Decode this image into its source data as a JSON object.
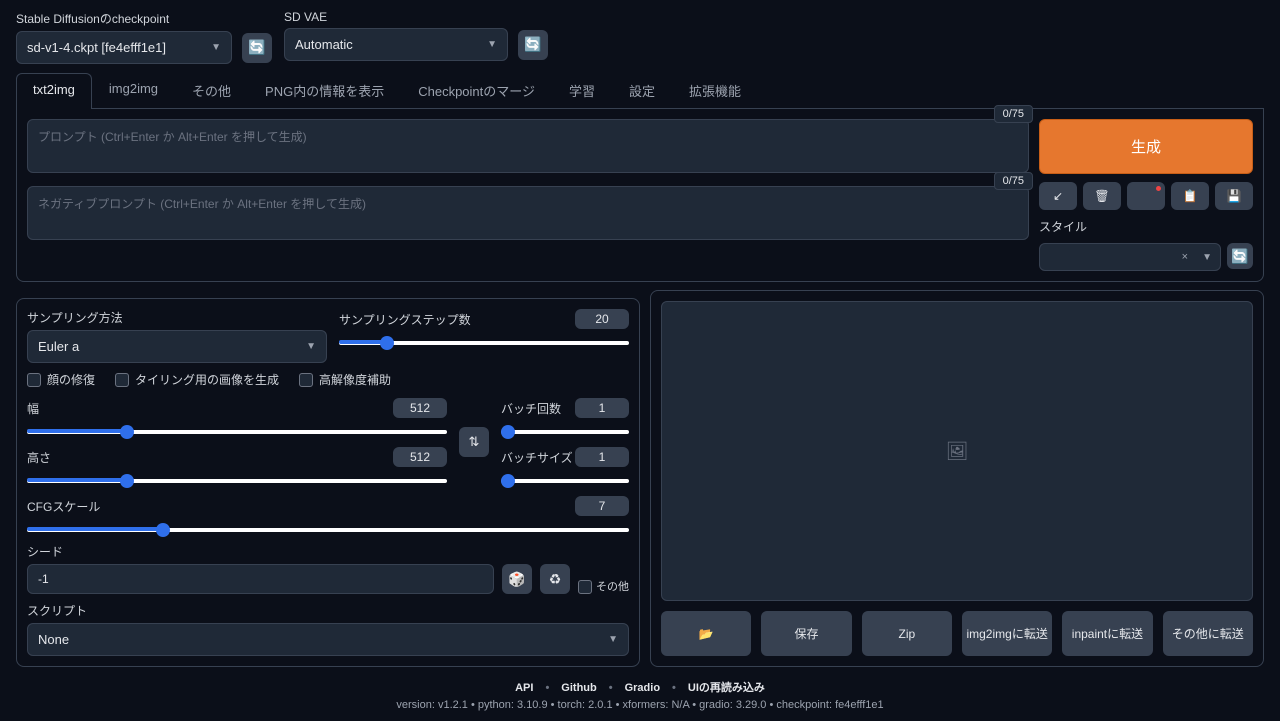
{
  "topbar": {
    "checkpoint_label": "Stable Diffusionのcheckpoint",
    "checkpoint_value": "sd-v1-4.ckpt [fe4efff1e1]",
    "vae_label": "SD VAE",
    "vae_value": "Automatic"
  },
  "tabs": [
    "txt2img",
    "img2img",
    "その他",
    "PNG内の情報を表示",
    "Checkpointのマージ",
    "学習",
    "設定",
    "拡張機能"
  ],
  "active_tab": 0,
  "prompt": {
    "placeholder": "プロンプト (Ctrl+Enter か Alt+Enter を押して生成)",
    "tokens": "0/75"
  },
  "neg_prompt": {
    "placeholder": "ネガティブプロンプト (Ctrl+Enter か Alt+Enter を押して生成)",
    "tokens": "0/75"
  },
  "generate": "生成",
  "style_label": "スタイル",
  "sampling": {
    "method_label": "サンプリング方法",
    "method_value": "Euler a",
    "steps_label": "サンプリングステップ数",
    "steps_value": "20",
    "steps_pct": 15
  },
  "checks": {
    "restore_faces": "顔の修復",
    "tiling": "タイリング用の画像を生成",
    "hires": "高解像度補助"
  },
  "width": {
    "label": "幅",
    "value": "512",
    "pct": 23
  },
  "height": {
    "label": "高さ",
    "value": "512",
    "pct": 23
  },
  "batch_count": {
    "label": "バッチ回数",
    "value": "1",
    "pct": 0
  },
  "batch_size": {
    "label": "バッチサイズ",
    "value": "1",
    "pct": 0
  },
  "cfg": {
    "label": "CFGスケール",
    "value": "7",
    "pct": 22
  },
  "seed": {
    "label": "シード",
    "value": "-1",
    "extra": "その他"
  },
  "script": {
    "label": "スクリプト",
    "value": "None"
  },
  "out_btns": {
    "folder": "📂",
    "save": "保存",
    "zip": "Zip",
    "img2img": "img2imgに転送",
    "inpaint": "inpaintに転送",
    "extras": "その他に転送"
  },
  "footer": {
    "links": [
      "API",
      "Github",
      "Gradio",
      "UIの再読み込み"
    ],
    "meta": "version: v1.2.1  •  python: 3.10.9  •  torch: 2.0.1  •  xformers: N/A  •  gradio: 3.29.0  •  checkpoint: fe4efff1e1"
  }
}
